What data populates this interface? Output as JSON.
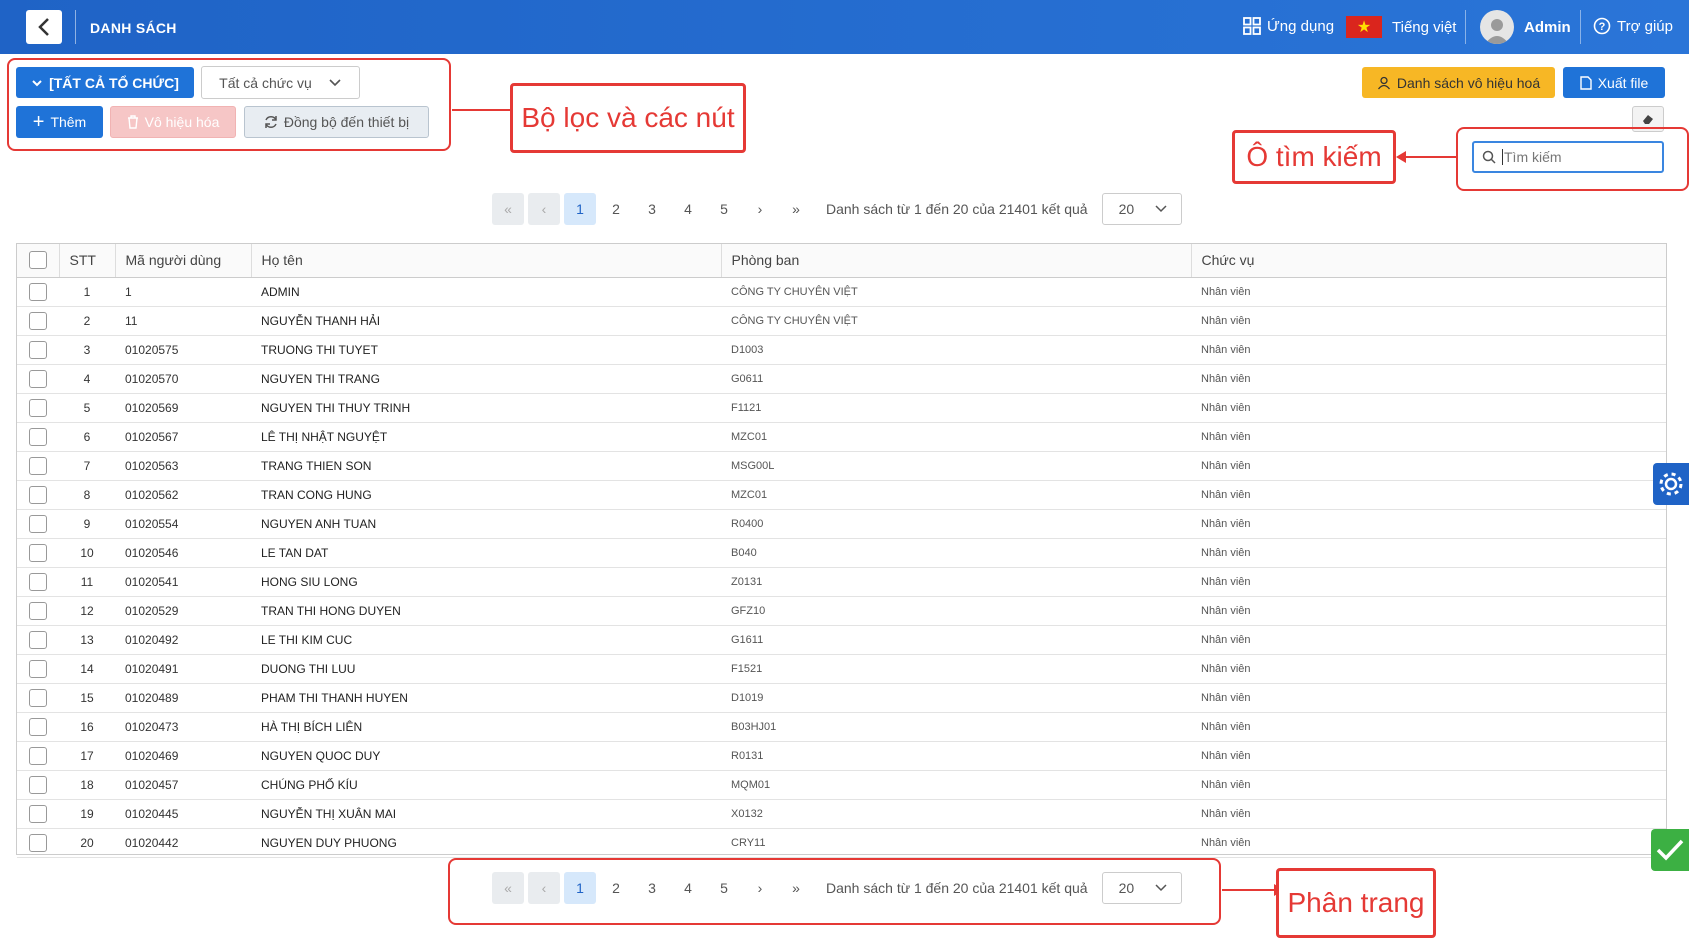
{
  "header": {
    "title": "DANH SÁCH",
    "apps_label": "Ứng dụng",
    "language_label": "Tiếng việt",
    "user_name": "Admin",
    "help_label": "Trợ giúp",
    "bg_color": "#2a6fd3"
  },
  "filters": {
    "org_button": "[TẤT CẢ TỔ CHỨC]",
    "position_select": "Tất cả chức vụ"
  },
  "actions": {
    "add": "Thêm",
    "disable": "Vô hiệu hóa",
    "sync": "Đồng bộ đến thiết bị",
    "disabled_list": "Danh sách vô hiệu hoá",
    "export": "Xuất file"
  },
  "search": {
    "placeholder": "Tìm kiếm"
  },
  "annotations": {
    "filters": "Bộ lọc và các nút",
    "search": "Ô tìm kiếm",
    "pagination": "Phân trang",
    "color": "#e53935"
  },
  "pagination": {
    "first": "«",
    "prev": "‹",
    "pages": [
      "1",
      "2",
      "3",
      "4",
      "5"
    ],
    "next": "›",
    "last": "»",
    "info": "Danh sách từ 1 đến 20 của 21401 kết quả",
    "page_size": "20"
  },
  "table": {
    "headers": [
      "STT",
      "Mã người dùng",
      "Họ tên",
      "Phòng ban",
      "Chức vụ"
    ],
    "rows": [
      [
        "1",
        "1",
        "ADMIN",
        "CÔNG TY CHUYÊN VIỆT",
        "Nhân viên"
      ],
      [
        "2",
        "11",
        "NGUYỄN THANH HẢI",
        "CÔNG TY CHUYÊN VIỆT",
        "Nhân viên"
      ],
      [
        "3",
        "01020575",
        "TRUONG THI TUYET",
        "D1003",
        "Nhân viên"
      ],
      [
        "4",
        "01020570",
        "NGUYEN THI TRANG",
        "G0611",
        "Nhân viên"
      ],
      [
        "5",
        "01020569",
        "NGUYEN THI THUY TRINH",
        "F1121",
        "Nhân viên"
      ],
      [
        "6",
        "01020567",
        "LÊ THỊ NHẬT NGUYỆT",
        "MZC01",
        "Nhân viên"
      ],
      [
        "7",
        "01020563",
        "TRANG THIEN SON",
        "MSG00L",
        "Nhân viên"
      ],
      [
        "8",
        "01020562",
        "TRAN CONG HUNG",
        "MZC01",
        "Nhân viên"
      ],
      [
        "9",
        "01020554",
        "NGUYEN ANH TUAN",
        "R0400",
        "Nhân viên"
      ],
      [
        "10",
        "01020546",
        "LE TAN DAT",
        "B040",
        "Nhân viên"
      ],
      [
        "11",
        "01020541",
        "HONG SIU LONG",
        "Z0131",
        "Nhân viên"
      ],
      [
        "12",
        "01020529",
        "TRAN THI HONG DUYEN",
        "GFZ10",
        "Nhân viên"
      ],
      [
        "13",
        "01020492",
        "LE THI KIM CUC",
        "G1611",
        "Nhân viên"
      ],
      [
        "14",
        "01020491",
        "DUONG THI LUU",
        "F1521",
        "Nhân viên"
      ],
      [
        "15",
        "01020489",
        "PHAM THI THANH HUYEN",
        "D1019",
        "Nhân viên"
      ],
      [
        "16",
        "01020473",
        "HÀ THỊ BÍCH LIÊN",
        "B03HJ01",
        "Nhân viên"
      ],
      [
        "17",
        "01020469",
        "NGUYEN QUOC DUY",
        "R0131",
        "Nhân viên"
      ],
      [
        "18",
        "01020457",
        "CHÚNG PHỐ KÍU",
        "MQM01",
        "Nhân viên"
      ],
      [
        "19",
        "01020445",
        "NGUYỄN THỊ XUÂN MAI",
        "X0132",
        "Nhân viên"
      ],
      [
        "20",
        "01020442",
        "NGUYEN DUY PHUONG",
        "CRY11",
        "Nhân viên"
      ]
    ]
  }
}
